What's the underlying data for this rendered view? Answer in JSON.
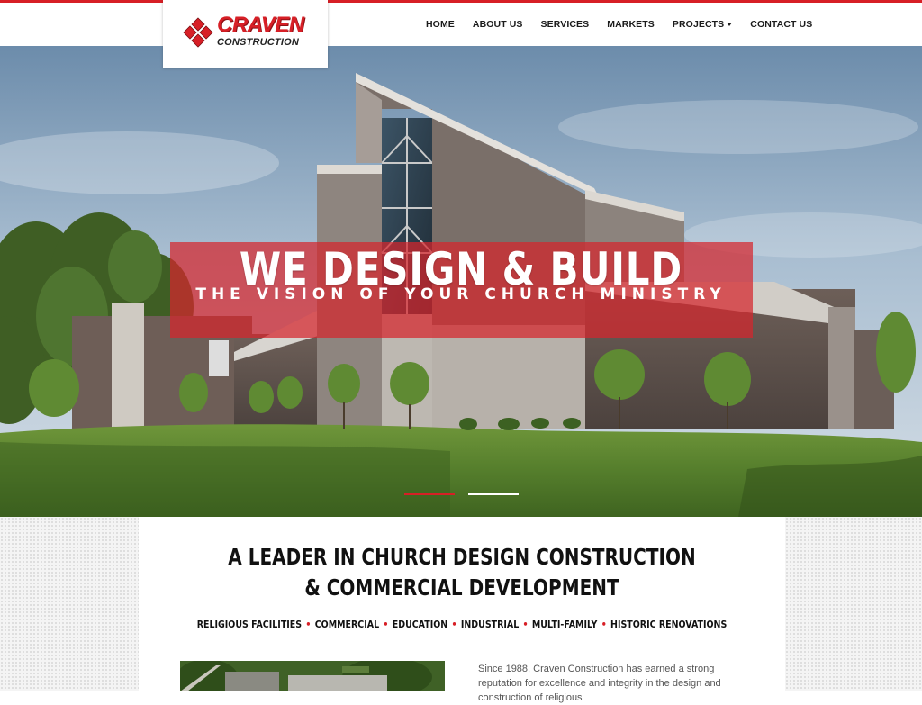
{
  "brand": {
    "name": "CRAVEN",
    "sub": "CONSTRUCTION",
    "colors": {
      "primary": "#d71f26",
      "dark": "#1b1b1b"
    }
  },
  "nav": {
    "items": [
      {
        "label": "HOME"
      },
      {
        "label": "ABOUT US"
      },
      {
        "label": "SERVICES"
      },
      {
        "label": "MARKETS"
      },
      {
        "label": "PROJECTS",
        "dropdown": true
      },
      {
        "label": "CONTACT US"
      }
    ]
  },
  "hero": {
    "title": "WE DESIGN & BUILD",
    "subtitle": "THE VISION OF YOUR CHURCH MINISTRY",
    "slides": {
      "count": 2,
      "active": 1
    }
  },
  "intro": {
    "headline_line1": "A LEADER IN CHURCH DESIGN CONSTRUCTION",
    "headline_line2": "& COMMERCIAL DEVELOPMENT",
    "tags": [
      "RELIGIOUS FACILITIES",
      "COMMERCIAL",
      "EDUCATION",
      "INDUSTRIAL",
      "MULTI-FAMILY",
      "HISTORIC RENOVATIONS"
    ],
    "tag_separator": "•",
    "text": "Since 1988, Craven Construction has earned a strong reputation for excellence and integrity in the design and construction of religious"
  }
}
